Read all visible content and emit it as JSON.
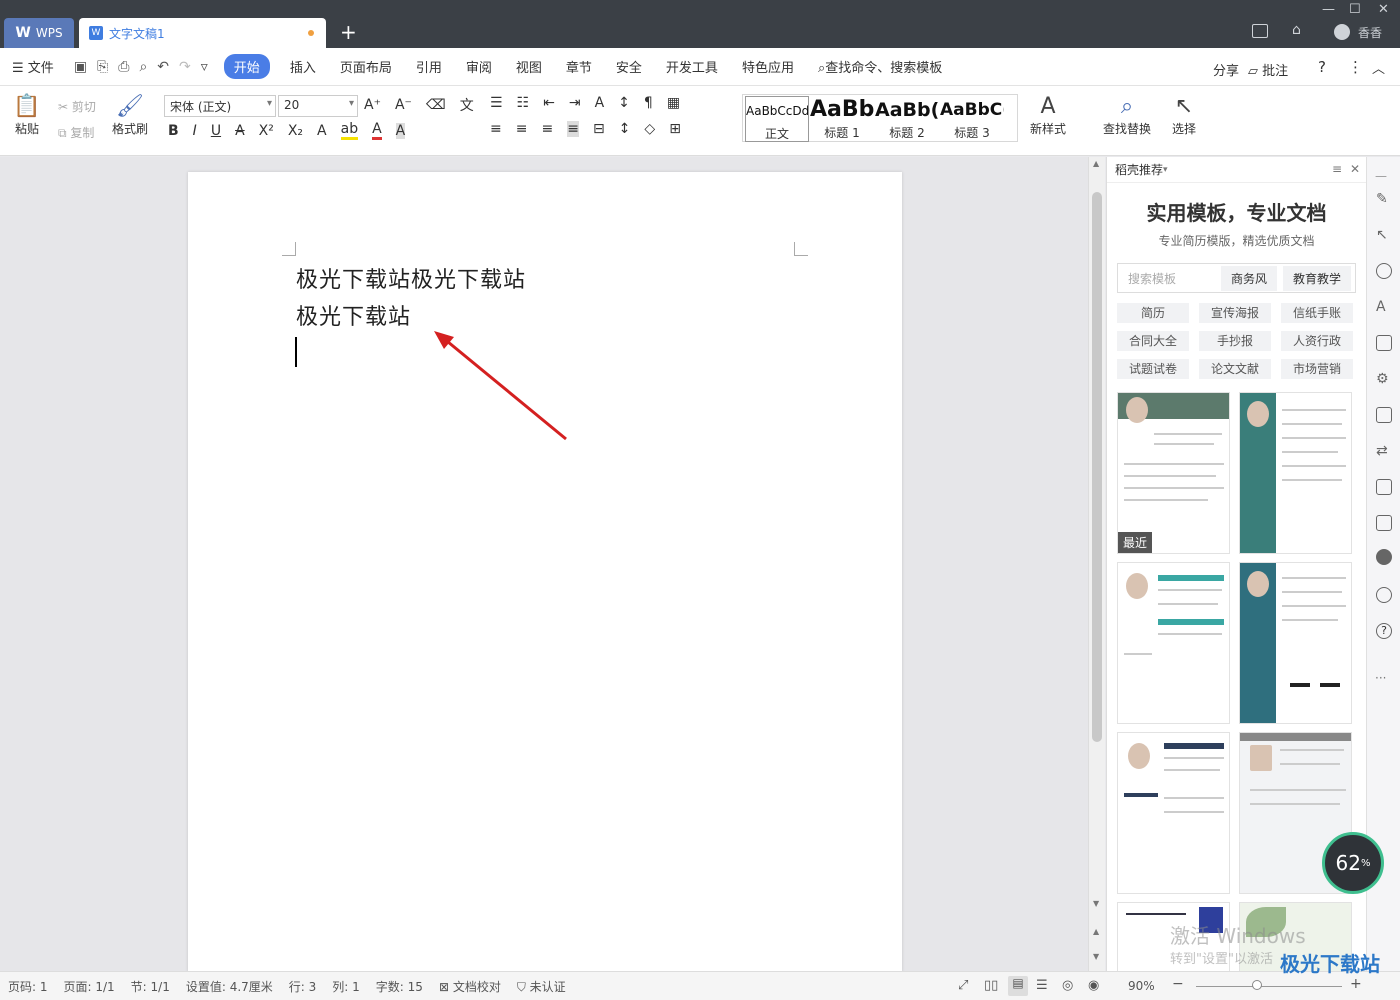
{
  "titlebar": {
    "app_tab": "WPS",
    "doc_tab": "文字文稿1",
    "user": "香香"
  },
  "menu": {
    "file": "文件",
    "items": [
      "开始",
      "插入",
      "页面布局",
      "引用",
      "审阅",
      "视图",
      "章节",
      "安全",
      "开发工具",
      "特色应用"
    ],
    "search": "查找命令、搜索模板",
    "share": "分享",
    "comment": "批注"
  },
  "ribbon": {
    "paste": "粘贴",
    "cut": "剪切",
    "copy": "复制",
    "format_painter": "格式刷",
    "font_name": "宋体 (正文)",
    "font_size": "20",
    "styles": [
      {
        "preview": "AaBbCcDd",
        "name": "正文"
      },
      {
        "preview": "AaBb",
        "name": "标题 1"
      },
      {
        "preview": "AaBb(",
        "name": "标题 2"
      },
      {
        "preview": "AaBbC(",
        "name": "标题 3"
      }
    ],
    "new_style": "新样式",
    "find_replace": "查找替换",
    "select": "选择"
  },
  "document": {
    "lines": [
      "极光下载站极光下载站",
      "极光下载站"
    ]
  },
  "panel": {
    "header": "稻壳推荐",
    "title": "实用模板，专业文档",
    "subtitle": "专业简历模版，精选优质文档",
    "search_placeholder": "搜索模板",
    "chips": [
      "商务风",
      "教育教学"
    ],
    "categories": [
      "简历",
      "宣传海报",
      "信纸手账",
      "合同大全",
      "手抄报",
      "人资行政",
      "试题试卷",
      "论文文献",
      "市场营销"
    ],
    "recent_label": "最近"
  },
  "status": {
    "page": "页码: 1",
    "pages": "页面: 1/1",
    "section": "节: 1/1",
    "position": "设置值: 4.7厘米",
    "row": "行: 3",
    "col": "列: 1",
    "words": "字数: 15",
    "proof": "文档校对",
    "auth": "未认证",
    "zoom": "90%"
  },
  "gauge": {
    "value": "62",
    "unit": "%"
  },
  "watermark": {
    "line1": "激活 Windows",
    "line2": "转到\"设置\"以激活",
    "brand": "极光下载站"
  },
  "colors": {
    "accent": "#4a7de6",
    "titlebar": "#3b4046",
    "arrow": "#d42020"
  }
}
